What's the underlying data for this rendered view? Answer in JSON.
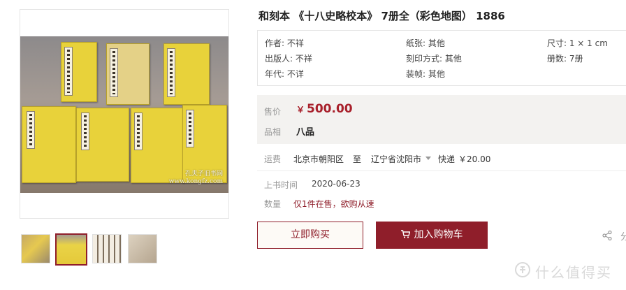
{
  "product": {
    "title": "和刻本 《十八史略校本》 7册全（彩色地图） 1886",
    "attributes": [
      {
        "label": "作者",
        "value": "不祥",
        "text": "作者: 不祥"
      },
      {
        "label": "纸张",
        "value": "其他",
        "text": "纸张: 其他"
      },
      {
        "label": "尺寸",
        "value": "1 × 1 cm",
        "text": "尺寸: 1 × 1 cm"
      },
      {
        "label": "出版人",
        "value": "不祥",
        "text": "出版人: 不祥"
      },
      {
        "label": "刻印方式",
        "value": "其他",
        "text": "刻印方式: 其他"
      },
      {
        "label": "册数",
        "value": "7册",
        "text": "册数: 7册"
      },
      {
        "label": "年代",
        "value": "不详",
        "text": "年代: 不详"
      },
      {
        "label": "装帧",
        "value": "其他",
        "text": "装帧: 其他"
      }
    ]
  },
  "image": {
    "watermark_line1": "孔夫子旧书网",
    "watermark_line2": "www.kongfz.com"
  },
  "pricing": {
    "price_label": "售价",
    "currency_symbol": "￥",
    "price": "500.00",
    "condition_label": "品相",
    "condition": "八品"
  },
  "shipping": {
    "label": "运费",
    "from": "北京市朝阳区",
    "to_word": "至",
    "to": "辽宁省沈阳市",
    "method": "快递",
    "fee": "￥20.00"
  },
  "listing": {
    "date_label": "上书时间",
    "date": "2020-06-23",
    "qty_label": "数量",
    "qty_text": "仅1件在售，欲购从速"
  },
  "actions": {
    "buy_now": "立即购买",
    "add_to_cart": "加入购物车",
    "share": "分"
  },
  "brand": {
    "text": "什么值得买"
  },
  "colors": {
    "accent": "#8f1e2a",
    "price": "#a8202b",
    "book_yellow": "#e8d23a"
  },
  "icons": [
    "cart-icon",
    "share-icon",
    "brand-logo-icon",
    "dropdown-caret-icon"
  ]
}
